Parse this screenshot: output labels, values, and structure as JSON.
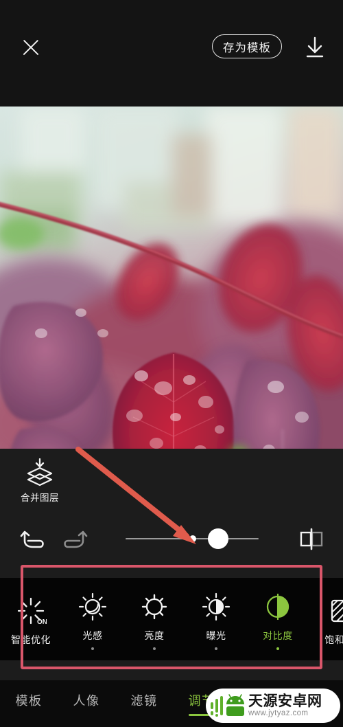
{
  "topbar": {
    "close_icon": "close-icon",
    "save_template_label": "存为模板",
    "download_icon": "download-icon"
  },
  "photo": {
    "description": "红色雨后叶片特写",
    "alt_icon": "photo-preview"
  },
  "edit_panel": {
    "merge_layer": {
      "icon": "merge-layers-icon",
      "label": "合并图层"
    },
    "undo_icon": "undo-icon",
    "redo_icon": "redo-icon",
    "compare_icon": "compare-before-after-icon",
    "slider": {
      "value": 14,
      "min": -50,
      "max": 50,
      "zero_mark": 0
    }
  },
  "adjust_tools": [
    {
      "label": "智能优化",
      "icon": "smart-optimize-icon",
      "badge": "ON",
      "active": false,
      "has_dot": false
    },
    {
      "label": "光感",
      "icon": "light-sense-icon",
      "badge": "",
      "active": false,
      "has_dot": true
    },
    {
      "label": "亮度",
      "icon": "brightness-icon",
      "badge": "",
      "active": false,
      "has_dot": true
    },
    {
      "label": "曝光",
      "icon": "exposure-icon",
      "badge": "",
      "active": false,
      "has_dot": true
    },
    {
      "label": "对比度",
      "icon": "contrast-icon",
      "badge": "",
      "active": true,
      "has_dot": true
    },
    {
      "label": "饱和度",
      "icon": "saturation-icon",
      "badge": "",
      "active": false,
      "has_dot": false
    }
  ],
  "tabs": [
    {
      "label": "模板",
      "active": false
    },
    {
      "label": "人像",
      "active": false
    },
    {
      "label": "滤镜",
      "active": false
    },
    {
      "label": "调节",
      "active": true
    }
  ],
  "watermark": {
    "title": "天源安卓网",
    "url": "www.jytyaz.com",
    "logo_icon": "android-logo-icon"
  },
  "annotation": {
    "rect_color": "#d9566a",
    "arrow_color": "#e05b4c"
  },
  "colors": {
    "accent_green": "#8CC63F",
    "panel_bg": "#1c1c1c",
    "strip_bg": "#050505",
    "topbar_bg": "#141414"
  }
}
